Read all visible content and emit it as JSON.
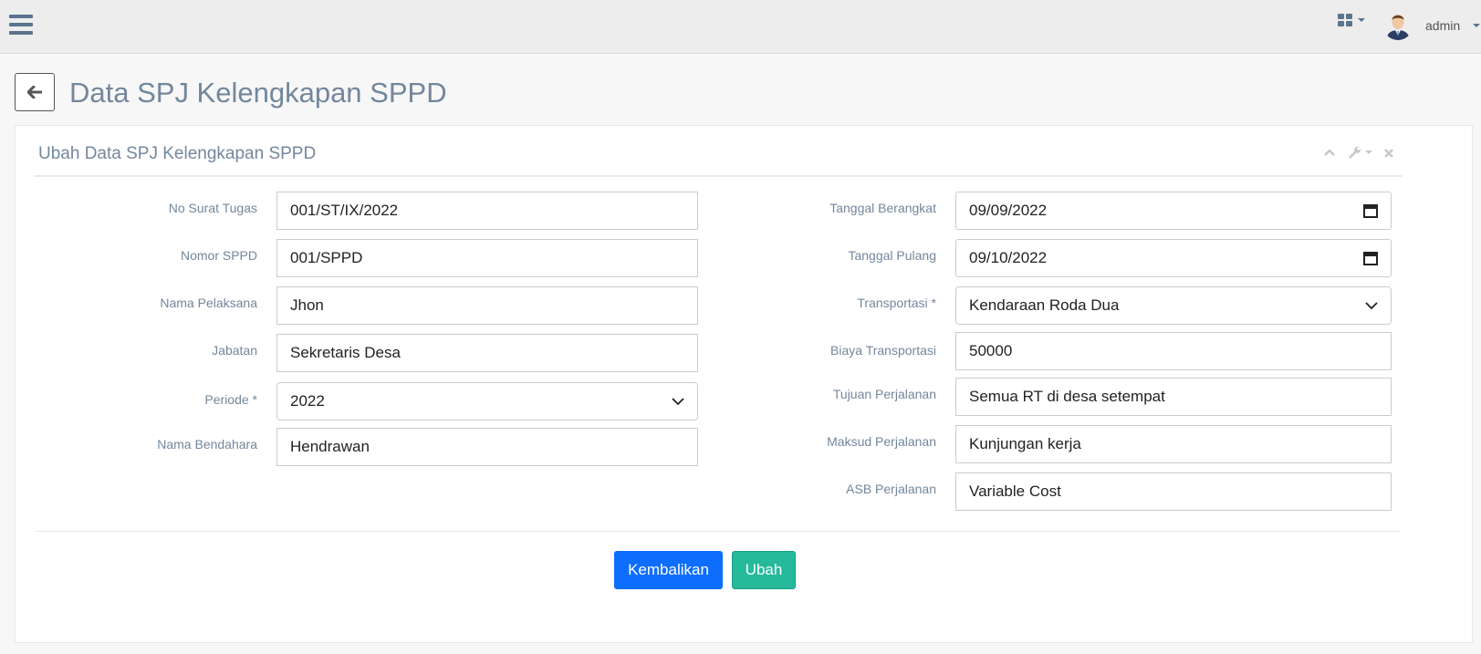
{
  "header": {
    "username": "admin"
  },
  "page": {
    "title": "Data SPJ Kelengkapan SPPD"
  },
  "panel": {
    "title": "Ubah Data SPJ Kelengkapan SPPD"
  },
  "form_left": [
    {
      "label": "No Surat Tugas",
      "value": "001/ST/IX/2022",
      "type": "text"
    },
    {
      "label": "Nomor SPPD",
      "value": "001/SPPD",
      "type": "text"
    },
    {
      "label": "Nama Pelaksana",
      "value": "Jhon",
      "type": "text"
    },
    {
      "label": "Jabatan",
      "value": "Sekretaris Desa",
      "type": "text"
    },
    {
      "label": "Periode *",
      "value": "2022",
      "type": "select"
    },
    {
      "label": "Nama Bendahara",
      "value": "Hendrawan",
      "type": "text"
    }
  ],
  "form_right": [
    {
      "label": "Tanggal Berangkat",
      "value": "09/09/2022",
      "type": "date"
    },
    {
      "label": "Tanggal Pulang",
      "value": "09/10/2022",
      "type": "date"
    },
    {
      "label": "Transportasi *",
      "value": "Kendaraan Roda Dua",
      "type": "select"
    },
    {
      "label": "Biaya Transportasi",
      "value": "50000",
      "type": "text"
    },
    {
      "label": "Tujuan Perjalanan",
      "value": "Semua RT di desa setempat",
      "type": "text"
    },
    {
      "label": "Maksud Perjalanan",
      "value": "Kunjungan kerja",
      "type": "text"
    },
    {
      "label": "ASB Perjalanan",
      "value": "Variable Cost",
      "type": "text"
    }
  ],
  "actions": {
    "back_label": "Kembalikan",
    "submit_label": "Ubah"
  },
  "icons": {
    "menu": "hamburger-icon",
    "apps": "grid-icon",
    "back": "arrow-left-icon",
    "collapse": "chevron-up-icon",
    "settings": "wrench-icon",
    "close": "close-icon",
    "calendar": "calendar-icon",
    "dropdown": "chevron-down-icon"
  },
  "colors": {
    "primary": "#0d6efd",
    "success": "#26b99a",
    "text": "#73879c"
  }
}
